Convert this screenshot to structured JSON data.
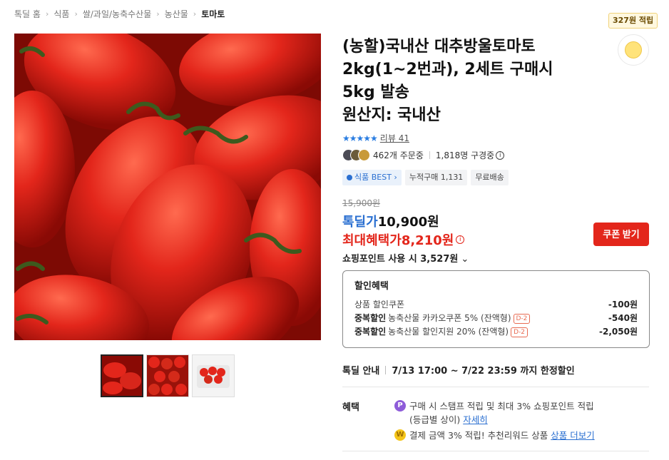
{
  "breadcrumb": [
    "톡딜 홈",
    "식품",
    "쌀/과일/농축수산물",
    "농산물",
    "토마토"
  ],
  "reward": {
    "tag": "327원 적립",
    "icon": "coin-icon"
  },
  "product": {
    "title": "(농할)국내산 대추방울토마토 2kg(1~2번과), 2세트 구매시 5kg 발송",
    "origin": "원산지: 국내산",
    "stars": "★★★★★",
    "review": "리뷰 41",
    "orders": "462개 주문중",
    "subscribers": "1,818명 구경중",
    "badges": {
      "best": "식품 BEST",
      "cumulative": "누적구매 1,131",
      "shipping": "무료배송"
    }
  },
  "price": {
    "original": "15,900원",
    "deal_label": "톡딜가",
    "deal_amount": "10,900원",
    "max_label": "최대혜택가",
    "max_amount": "8,210원",
    "points": "쇼핑포인트 사용 시 3,527원",
    "coupon_button": "쿠폰 받기"
  },
  "discounts": {
    "title": "할인혜택",
    "rows": [
      {
        "strong": "",
        "text": "상품 할인쿠폰",
        "tag": "",
        "value": "-100원"
      },
      {
        "strong": "중복할인",
        "text": "농축산물 카카오쿠폰 5% (잔액형)",
        "tag": "D-2",
        "value": "-540원"
      },
      {
        "strong": "중복할인",
        "text": "농축산물 할인지원 20% (잔액형)",
        "tag": "D-2",
        "value": "-2,050원"
      }
    ]
  },
  "notice": {
    "label": "톡딜 안내",
    "text": "7/13 17:00 ~ 7/22 23:59 까지 한정할인"
  },
  "benefits": {
    "label": "혜택",
    "line1": "구매 시 스탬프 적립 및 최대 3% 쇼핑포인트 적립",
    "line1_sub": "(등급별 상이)",
    "line1_link": "자세히",
    "line2": "결제 금액 3% 적립! 추천리워드 상품",
    "line2_link": "상품 더보기"
  },
  "colors": {
    "accent_blue": "#2a6fd1",
    "accent_red": "#e3261b"
  }
}
